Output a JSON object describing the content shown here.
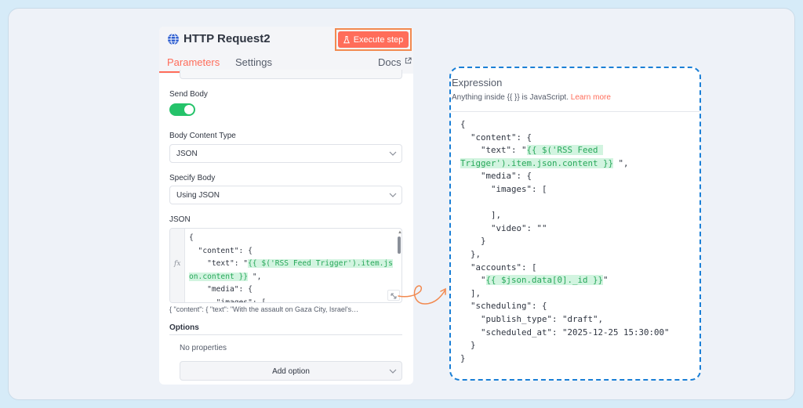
{
  "node": {
    "title": "HTTP Request2",
    "execute_label": "Execute step"
  },
  "tabs": {
    "parameters": "Parameters",
    "settings": "Settings",
    "docs": "Docs"
  },
  "fields": {
    "send_body_label": "Send Body",
    "send_body_enabled": true,
    "body_content_type_label": "Body Content Type",
    "body_content_type_value": "JSON",
    "specify_body_label": "Specify Body",
    "specify_body_value": "Using JSON",
    "json_label": "JSON",
    "fx_label": "fx",
    "json_lines": [
      {
        "text": "{",
        "hl": ""
      },
      {
        "text": "  \"content\": {",
        "hl": ""
      },
      {
        "text": "    \"text\": \"",
        "hl": "{{ $('RSS Feed Trigger').item.js"
      },
      {
        "text": "",
        "hl": "on.content }}",
        "after": " \","
      },
      {
        "text": "    \"media\": {",
        "hl": ""
      },
      {
        "text": "      \"images\": [",
        "hl": ""
      }
    ],
    "json_preview": "{   \"content\": {    \"text\": \"With the assault on Gaza City, Israel's…",
    "options_label": "Options",
    "no_properties": "No properties",
    "add_option_label": "Add option"
  },
  "expression": {
    "title": "Expression",
    "subtitle_prefix": "Anything inside {{  }} is JavaScript. ",
    "learn_more": "Learn more",
    "lines": [
      {
        "text": "{"
      },
      {
        "text": "  \"content\": {"
      },
      {
        "text": "    \"text\": \"",
        "hl": "{{ $('RSS Feed "
      },
      {
        "text": "",
        "hl": "Trigger').item.json.content }}",
        "after": " \","
      },
      {
        "text": "    \"media\": {"
      },
      {
        "text": "      \"images\": ["
      },
      {
        "text": ""
      },
      {
        "text": "      ],"
      },
      {
        "text": "      \"video\": \"\""
      },
      {
        "text": "    }"
      },
      {
        "text": "  },"
      },
      {
        "text": "  \"accounts\": ["
      },
      {
        "text": "    \"",
        "hl": "{{ $json.data[0]._id }}",
        "after": "\""
      },
      {
        "text": "  ],"
      },
      {
        "text": "  \"scheduling\": {"
      },
      {
        "text": "    \"publish_type\": \"draft\","
      },
      {
        "text": "    \"scheduled_at\": \"2025-12-25 15:30:00\""
      },
      {
        "text": "  }"
      },
      {
        "text": "}"
      }
    ]
  },
  "colors": {
    "accent": "#ff6d5a",
    "toggle_on": "#25c36a",
    "highlight_text": "#28a85a",
    "highlight_bg": "#d2f4e0",
    "dashed_border": "#1a7fd6",
    "arrow": "#f28a50"
  },
  "icons": {
    "title": "globe-icon",
    "execute": "flask-icon",
    "docs": "external-link-icon",
    "dropdown": "chevron-down-icon",
    "expand": "expand-icon"
  }
}
